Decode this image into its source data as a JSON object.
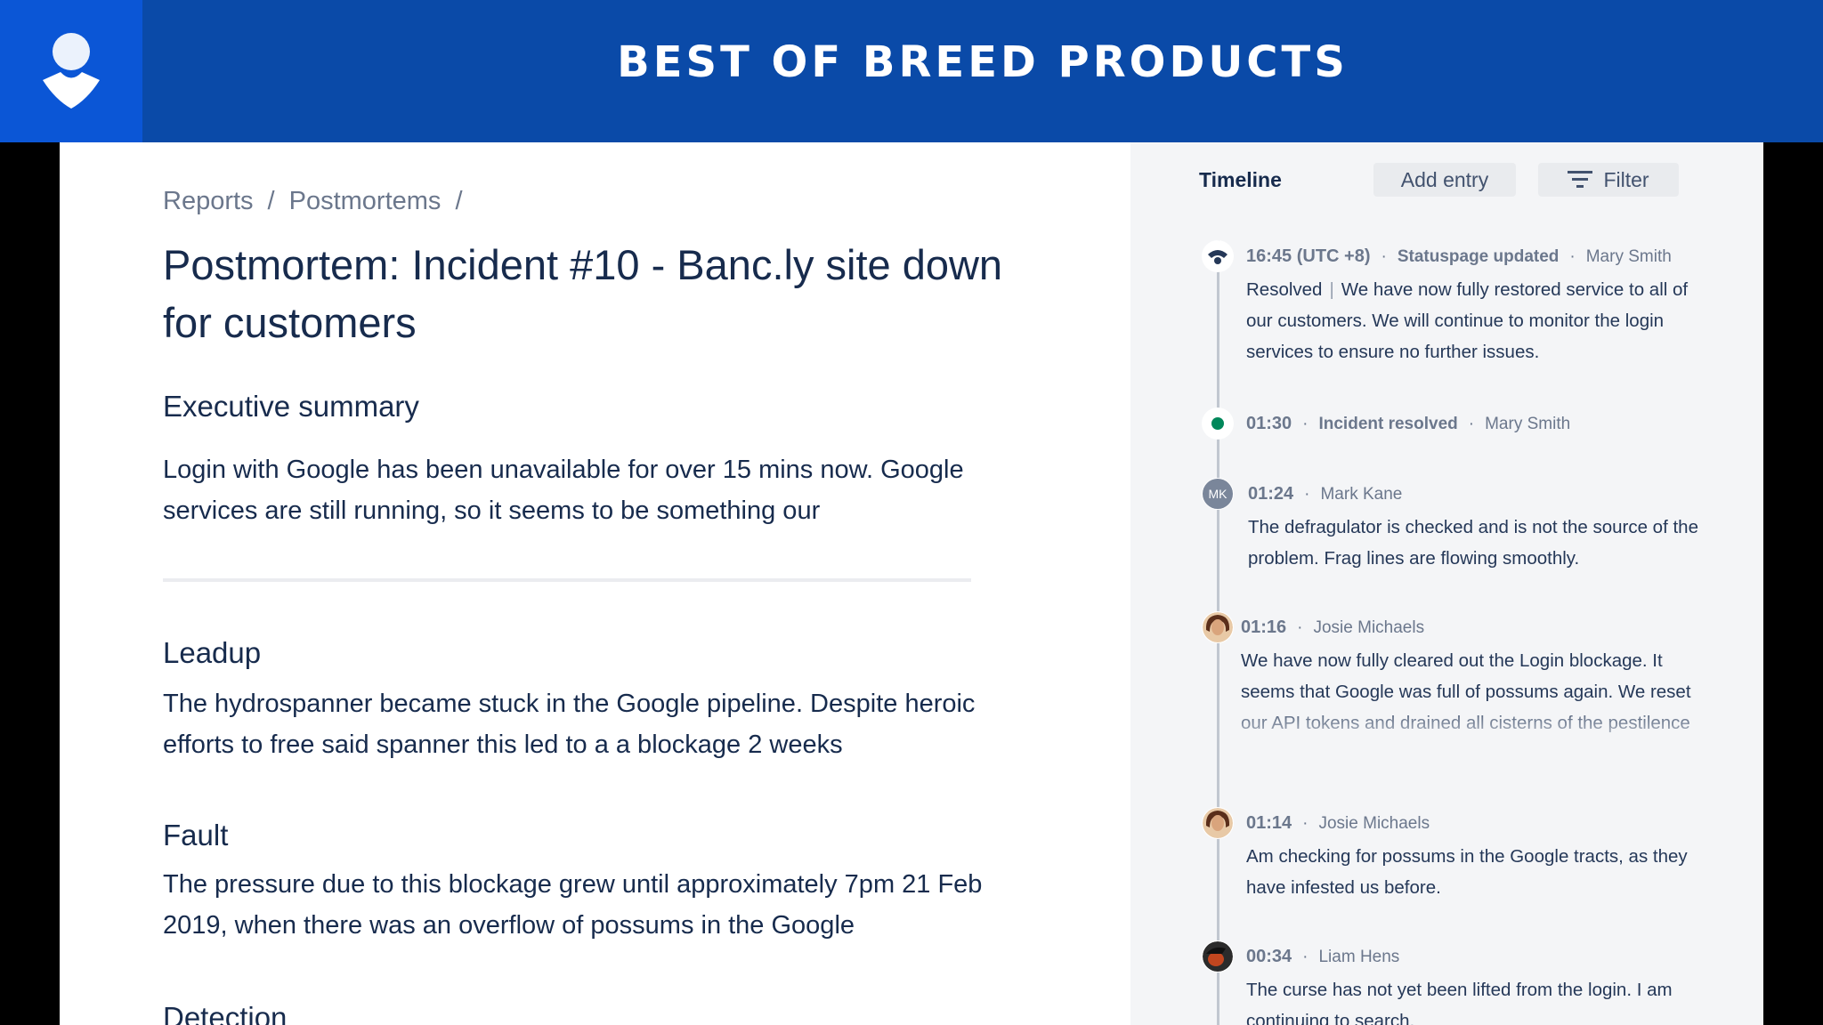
{
  "banner": {
    "title": "BEST OF BREED PRODUCTS",
    "logo_icon": "atlassian-opsgenie-logo-icon"
  },
  "breadcrumb": {
    "items": [
      "Reports",
      "Postmortems"
    ],
    "separator": "/"
  },
  "document": {
    "title": "Postmortem: Incident #10 - Banc.ly site down for customers",
    "sections": [
      {
        "heading": "Executive summary",
        "body": "Login with Google has been unavailable for over 15 mins now. Google services are still running, so it seems to be something our"
      },
      {
        "heading": "Leadup",
        "body": "The hydrospanner became stuck in the Google pipeline. Despite heroic efforts to free said spanner this led to a a blockage 2 weeks"
      },
      {
        "heading": "Fault",
        "body": "The pressure due to this blockage grew until approximately 7pm 21 Feb 2019, when there was an overflow of possums in the Google"
      },
      {
        "heading": "Detection",
        "body": ""
      }
    ]
  },
  "timeline": {
    "title": "Timeline",
    "add_entry_label": "Add entry",
    "filter_label": "Filter",
    "filter_icon": "filter-icon",
    "entries": [
      {
        "time": "16:45 (UTC +8)",
        "event": "Statuspage updated",
        "author": "Mary Smith",
        "status": "Resolved",
        "text": "We have now fully restored service to all of our customers. We will continue to monitor the login services to ensure no further issues.",
        "marker": "statuspage-icon"
      },
      {
        "time": "01:30",
        "event": "Incident resolved",
        "author": "Mary Smith",
        "marker": "resolved-dot-icon",
        "marker_color": "#00875a"
      },
      {
        "time": "01:24",
        "author": "Mark Kane",
        "initials": "MK",
        "text": "The defragulator is checked and is not the source of the problem. Frag lines are flowing smoothly."
      },
      {
        "time": "01:16",
        "author": "Josie Michaels",
        "text": "We have now fully cleared out the Login blockage. It seems that Google was full of possums again. We reset our API tokens and drained all cisterns of the pestilence but we will remain ever vigilant"
      },
      {
        "time": "01:14",
        "author": "Josie Michaels",
        "text": "Am checking for possums in the Google tracts, as they have infested us before."
      },
      {
        "time": "00:34",
        "author": "Liam Hens",
        "text": "The curse has not yet been lifted from the login. I am continuing to search."
      }
    ]
  },
  "colors": {
    "banner_bg": "#0a4aa8",
    "logo_bg": "#0b56d6",
    "text_primary": "#172b4d",
    "text_subtle": "#6b778c",
    "timeline_bg": "#f4f5f7",
    "resolved_green": "#00875a"
  }
}
